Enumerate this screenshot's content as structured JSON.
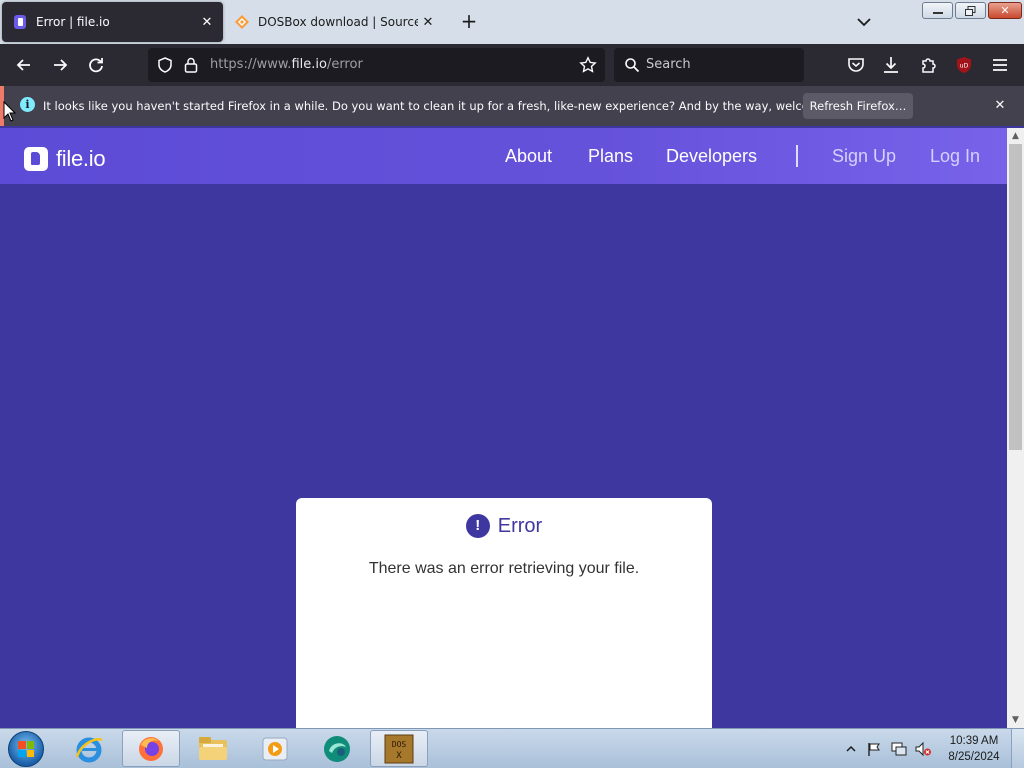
{
  "browser": {
    "tabs": [
      {
        "title": "Error | file.io",
        "active": true,
        "favicon": "fileio-favicon"
      },
      {
        "title": "DOSBox download | SourceForge",
        "active": false,
        "favicon": "sourceforge-favicon"
      }
    ],
    "new_tab_label": "+",
    "url_prefix": "https://www.",
    "url_domain": "file.io",
    "url_path": "/error",
    "search_placeholder": "Search"
  },
  "notification": {
    "message": "It looks like you haven't started Firefox in a while. Do you want to clean it up for a fresh, like-new experience? And by the way, welcome back!",
    "button_label": "Refresh Firefox…"
  },
  "site": {
    "logo_text": "file.io",
    "nav": [
      "About",
      "Plans",
      "Developers"
    ],
    "auth": [
      "Sign Up",
      "Log In"
    ],
    "error_icon": "!",
    "error_title": "Error",
    "error_message": "There was an error retrieving your file."
  },
  "taskbar": {
    "time": "10:39 AM",
    "date": "8/25/2024",
    "apps": [
      "internet-explorer",
      "firefox",
      "file-explorer",
      "media-player",
      "app-teal",
      "dosbox"
    ]
  },
  "colors": {
    "page_bg": "#3f37a0",
    "header_bg": "#6552db",
    "browser_dark": "#2b2a33"
  }
}
